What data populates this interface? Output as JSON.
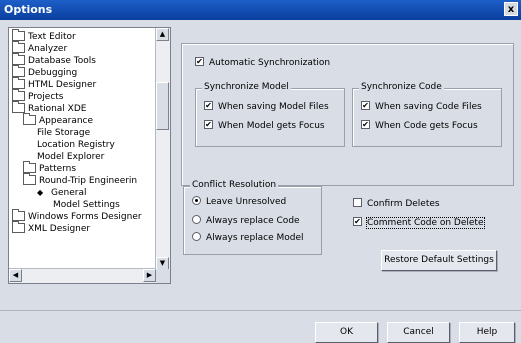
{
  "window": {
    "title": "Options",
    "close_label": "x"
  },
  "tree": {
    "items": [
      {
        "label": "Text Editor",
        "icon": "folder-icon",
        "indent": 0
      },
      {
        "label": "Analyzer",
        "icon": "folder-icon",
        "indent": 0
      },
      {
        "label": "Database Tools",
        "icon": "folder-icon",
        "indent": 0
      },
      {
        "label": "Debugging",
        "icon": "folder-icon",
        "indent": 0
      },
      {
        "label": "HTML Designer",
        "icon": "folder-icon",
        "indent": 0
      },
      {
        "label": "Projects",
        "icon": "folder-icon",
        "indent": 0
      },
      {
        "label": "Rational XDE",
        "icon": "folder-open-icon",
        "indent": 0
      },
      {
        "label": "Appearance",
        "icon": "folder-icon",
        "indent": 1
      },
      {
        "label": "File Storage",
        "icon": "",
        "indent": 2
      },
      {
        "label": "Location Registry",
        "icon": "",
        "indent": 2
      },
      {
        "label": "Model Explorer",
        "icon": "",
        "indent": 2
      },
      {
        "label": "Patterns",
        "icon": "folder-icon",
        "indent": 1
      },
      {
        "label": "Round-Trip Engineerin",
        "icon": "folder-open-icon",
        "indent": 1
      },
      {
        "label": "General",
        "icon": "diamond-icon",
        "indent": 2
      },
      {
        "label": "Model Settings",
        "icon": "",
        "indent": 3
      },
      {
        "label": "Windows Forms Designer",
        "icon": "folder-icon",
        "indent": 0
      },
      {
        "label": "XML Designer",
        "icon": "folder-icon",
        "indent": 0
      }
    ]
  },
  "auto_sync": {
    "label": "Automatic Synchronization",
    "checked": true
  },
  "sync_model": {
    "title": "Synchronize Model",
    "options": [
      {
        "label": "When saving Model Files",
        "checked": true
      },
      {
        "label": "When Model gets Focus",
        "checked": true
      }
    ]
  },
  "sync_code": {
    "title": "Synchronize Code",
    "options": [
      {
        "label": "When saving Code Files",
        "checked": true
      },
      {
        "label": "When Code gets Focus",
        "checked": true
      }
    ]
  },
  "conflict": {
    "title": "Conflict Resolution",
    "options": [
      {
        "label": "Leave Unresolved",
        "selected": true
      },
      {
        "label": "Always replace Code",
        "selected": false
      },
      {
        "label": "Always replace Model",
        "selected": false
      }
    ]
  },
  "confirm_deletes": {
    "label": "Confirm Deletes",
    "checked": false
  },
  "comment_on_delete": {
    "label": "Comment Code on Delete",
    "checked": true
  },
  "buttons": {
    "restore": "Restore Default Settings",
    "ok": "OK",
    "cancel": "Cancel",
    "help": "Help"
  },
  "scroll_glyphs": {
    "up": "▲",
    "down": "▼",
    "left": "◀",
    "right": "▶"
  },
  "check_glyph": "✔"
}
